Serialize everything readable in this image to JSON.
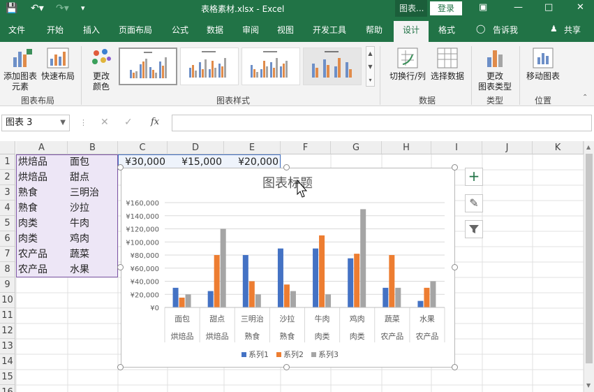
{
  "titlebar": {
    "title": "表格素材.xlsx  -  Excel",
    "context_label": "图表...",
    "login": "登录"
  },
  "tabs": [
    "文件",
    "开始",
    "插入",
    "页面布局",
    "公式",
    "数据",
    "审阅",
    "视图",
    "开发工具",
    "帮助",
    "设计",
    "格式",
    "告诉我",
    "共享"
  ],
  "ribbon": {
    "add_element": "添加图表",
    "add_element2": "元素",
    "quick_layout": "快速布局",
    "change_color": "更改",
    "change_color2": "颜色",
    "group_layout": "图表布局",
    "group_styles": "图表样式",
    "switch_row_col": "切换行/列",
    "select_data": "选择数据",
    "group_data": "数据",
    "change_type": "更改",
    "change_type2": "图表类型",
    "group_type": "类型",
    "move_chart": "移动图表",
    "group_location": "位置"
  },
  "namebox": "图表 3",
  "fx": "fx",
  "columns": [
    "A",
    "B",
    "C",
    "D",
    "E",
    "F",
    "G",
    "H",
    "I",
    "J",
    "K"
  ],
  "rows": [
    "1",
    "2",
    "3",
    "4",
    "5",
    "6",
    "7",
    "8",
    "9",
    "10",
    "11",
    "12",
    "13",
    "14",
    "15",
    "16"
  ],
  "cells": {
    "A": [
      "烘焙品",
      "烘焙品",
      "熟食",
      "熟食",
      "肉类",
      "肉类",
      "农产品",
      "农产品"
    ],
    "B": [
      "面包",
      "甜点",
      "三明治",
      "沙拉",
      "牛肉",
      "鸡肉",
      "蔬菜",
      "水果"
    ],
    "C1": "¥30,000",
    "D1": "¥15,000",
    "E1": "¥20,000"
  },
  "chart_data": {
    "type": "bar",
    "title": "图表标题",
    "categories": [
      "面包",
      "甜点",
      "三明治",
      "沙拉",
      "牛肉",
      "鸡肉",
      "蔬菜",
      "水果"
    ],
    "group_labels": [
      "烘焙品",
      "烘焙品",
      "熟食",
      "熟食",
      "肉类",
      "肉类",
      "农产品",
      "农产品"
    ],
    "series": [
      {
        "name": "系列1",
        "values": [
          30000,
          25000,
          80000,
          90000,
          90000,
          75000,
          30000,
          10000
        ],
        "color": "#4472c4"
      },
      {
        "name": "系列2",
        "values": [
          15000,
          80000,
          40000,
          35000,
          110000,
          82000,
          80000,
          30000
        ],
        "color": "#ed7d31"
      },
      {
        "name": "系列3",
        "values": [
          20000,
          120000,
          20000,
          25000,
          20000,
          150000,
          30000,
          40000
        ],
        "color": "#a5a5a5"
      }
    ],
    "yticks": [
      "¥0",
      "¥20,000",
      "¥40,000",
      "¥60,000",
      "¥80,000",
      "¥100,000",
      "¥120,000",
      "¥140,000",
      "¥160,000"
    ],
    "ylim": [
      0,
      160000
    ],
    "grid": true,
    "legend_position": "bottom"
  },
  "colors": {
    "excel_green": "#217346",
    "selection_fill": "#ede6f6",
    "selection_border": "#7e57a6"
  }
}
